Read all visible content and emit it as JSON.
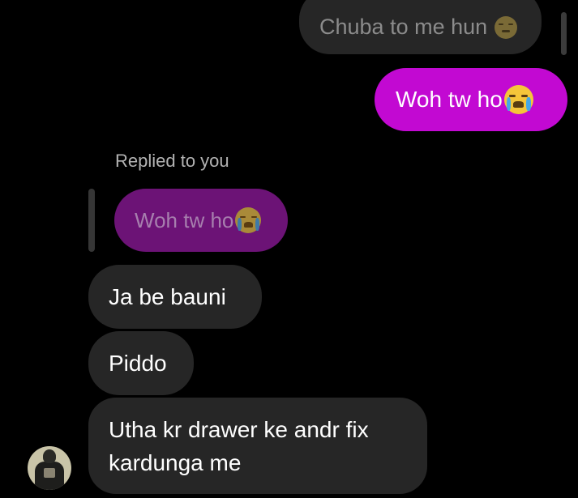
{
  "chat": {
    "quoted_top": {
      "text": "Chuba to me hun",
      "emoji": "pensive-face-icon"
    },
    "sent_message": {
      "text": "Woh tw ho",
      "emoji": "loudly-crying-face-icon"
    },
    "reply_label": "Replied to you",
    "quoted_reply": {
      "text": "Woh tw ho",
      "emoji": "loudly-crying-face-icon"
    },
    "received_messages": [
      {
        "text": "Ja be bauni"
      },
      {
        "text": "Piddo"
      },
      {
        "text": "Utha kr drawer ke andr fix kardunga me"
      }
    ],
    "avatar": "contact-avatar"
  },
  "colors": {
    "background": "#000000",
    "sent_bubble": "#c209d2",
    "received_bubble": "#262626",
    "quoted_reply_bubble": "#6c1376",
    "meta_text": "#b3b3b3"
  }
}
